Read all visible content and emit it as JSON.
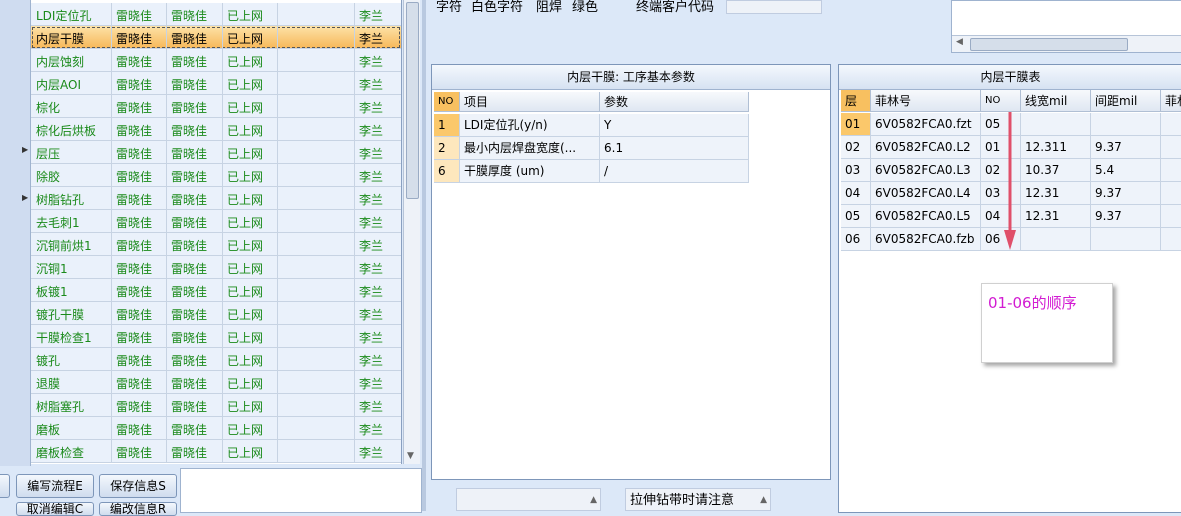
{
  "top": {
    "labels": [
      "字符",
      "白色字符",
      "阻焊",
      "绿色",
      "终端客户代码"
    ]
  },
  "process_grid": {
    "rows": [
      {
        "name": "LDI定位孔",
        "c2": "雷晓佳",
        "c3": "雷晓佳",
        "status": "已上网",
        "owner": "李兰"
      },
      {
        "name": "内层干膜",
        "c2": "雷晓佳",
        "c3": "雷晓佳",
        "status": "已上网",
        "owner": "李兰",
        "selected": true
      },
      {
        "name": "内层蚀刻",
        "c2": "雷晓佳",
        "c3": "雷晓佳",
        "status": "已上网",
        "owner": "李兰"
      },
      {
        "name": "内层AOI",
        "c2": "雷晓佳",
        "c3": "雷晓佳",
        "status": "已上网",
        "owner": "李兰"
      },
      {
        "name": "棕化",
        "c2": "雷晓佳",
        "c3": "雷晓佳",
        "status": "已上网",
        "owner": "李兰"
      },
      {
        "name": "棕化后烘板",
        "c2": "雷晓佳",
        "c3": "雷晓佳",
        "status": "已上网",
        "owner": "李兰"
      },
      {
        "name": "层压",
        "c2": "雷晓佳",
        "c3": "雷晓佳",
        "status": "已上网",
        "owner": "李兰"
      },
      {
        "name": "除胶",
        "c2": "雷晓佳",
        "c3": "雷晓佳",
        "status": "已上网",
        "owner": "李兰"
      },
      {
        "name": "树脂钻孔",
        "c2": "雷晓佳",
        "c3": "雷晓佳",
        "status": "已上网",
        "owner": "李兰"
      },
      {
        "name": "去毛刺1",
        "c2": "雷晓佳",
        "c3": "雷晓佳",
        "status": "已上网",
        "owner": "李兰"
      },
      {
        "name": "沉铜前烘1",
        "c2": "雷晓佳",
        "c3": "雷晓佳",
        "status": "已上网",
        "owner": "李兰"
      },
      {
        "name": "沉铜1",
        "c2": "雷晓佳",
        "c3": "雷晓佳",
        "status": "已上网",
        "owner": "李兰"
      },
      {
        "name": "板镀1",
        "c2": "雷晓佳",
        "c3": "雷晓佳",
        "status": "已上网",
        "owner": "李兰"
      },
      {
        "name": "镀孔干膜",
        "c2": "雷晓佳",
        "c3": "雷晓佳",
        "status": "已上网",
        "owner": "李兰"
      },
      {
        "name": "干膜检查1",
        "c2": "雷晓佳",
        "c3": "雷晓佳",
        "status": "已上网",
        "owner": "李兰"
      },
      {
        "name": "镀孔",
        "c2": "雷晓佳",
        "c3": "雷晓佳",
        "status": "已上网",
        "owner": "李兰"
      },
      {
        "name": "退膜",
        "c2": "雷晓佳",
        "c3": "雷晓佳",
        "status": "已上网",
        "owner": "李兰"
      },
      {
        "name": "树脂塞孔",
        "c2": "雷晓佳",
        "c3": "雷晓佳",
        "status": "已上网",
        "owner": "李兰"
      },
      {
        "name": "磨板",
        "c2": "雷晓佳",
        "c3": "雷晓佳",
        "status": "已上网",
        "owner": "李兰"
      },
      {
        "name": "磨板检查",
        "c2": "雷晓佳",
        "c3": "雷晓佳",
        "status": "已上网",
        "owner": "李兰"
      }
    ]
  },
  "buttons": {
    "edit_flow": "编写流程E",
    "save_info": "保存信息S",
    "cancel_partial": "取消编辑C",
    "partial2": "编改信息R"
  },
  "params": {
    "title": "内层干膜: 工序基本参数",
    "headers": [
      "NO",
      "项目",
      "参数"
    ],
    "rows": [
      {
        "no": "1",
        "item": "LDI定位孔(y/n)",
        "value": "Y"
      },
      {
        "no": "2",
        "item": "最小内层焊盘宽度(...",
        "value": "6.1"
      },
      {
        "no": "6",
        "item": "干膜厚度 (um)",
        "value": "/"
      }
    ]
  },
  "mid_bottom": {
    "notice": "拉伸钻带时请注意"
  },
  "film_table": {
    "title": "内层干膜表",
    "headers": [
      "层",
      "菲林号",
      "NO",
      "线宽mil",
      "间距mil",
      "菲林"
    ],
    "rows": [
      {
        "layer": "01",
        "film": "6V0582FCA0.fzt",
        "no": "05",
        "width": "",
        "gap": ""
      },
      {
        "layer": "02",
        "film": "6V0582FCA0.L2",
        "no": "01",
        "width": "12.311",
        "gap": "9.37"
      },
      {
        "layer": "03",
        "film": "6V0582FCA0.L3",
        "no": "02",
        "width": "10.37",
        "gap": "5.4"
      },
      {
        "layer": "04",
        "film": "6V0582FCA0.L4",
        "no": "03",
        "width": "12.31",
        "gap": "9.37"
      },
      {
        "layer": "05",
        "film": "6V0582FCA0.L5",
        "no": "04",
        "width": "12.31",
        "gap": "9.37"
      },
      {
        "layer": "06",
        "film": "6V0582FCA0.fzb",
        "no": "06",
        "width": "",
        "gap": ""
      }
    ]
  },
  "annotation": {
    "note": "01-06的顺序",
    "color": "#d21bd2",
    "arrow_color": "#e0506a"
  }
}
